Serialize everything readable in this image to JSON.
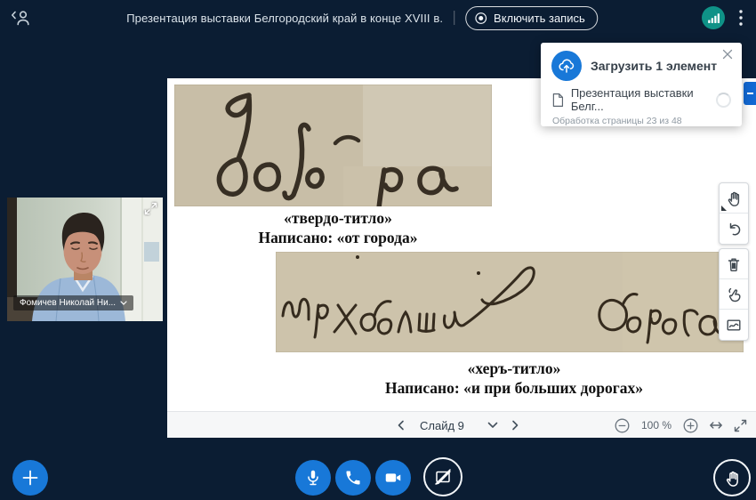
{
  "topbar": {
    "title": "Презентация выставки Белгородский край в конце XVIII в.",
    "record_label": "Включить запись"
  },
  "upload": {
    "title": "Загрузить 1 элемент",
    "file_name": "Презентация выставки Белг...",
    "progress": "Обработка страницы 23 из 48"
  },
  "participant": {
    "name": "Фомичев Николай Ни..."
  },
  "slide": {
    "caption_top": {
      "line1": "«твердо-титло»",
      "line2": "Написано: «от города»"
    },
    "caption_bottom": {
      "line1": "«херъ-титло»",
      "line2": "Написано: «и при больших дорогах»"
    },
    "footer": {
      "slide_label": "Слайд 9",
      "zoom_level": "100 %"
    }
  },
  "colors": {
    "background_navy": "#0b1d33",
    "accent_blue": "#1878d8",
    "connection_teal": "#0f9287",
    "side_tab_blue": "#1268d3",
    "parchment": "#cbc1aa"
  },
  "icons": {
    "topbar": [
      "leave-person-icon",
      "record-icon",
      "signal-bars-icon",
      "kebab-menu-icon"
    ],
    "toolbar": [
      "pan-hand-icon",
      "undo-icon",
      "trash-icon",
      "pointer-finger-icon",
      "curve-chart-icon"
    ],
    "bottom_bar": [
      "plus-icon",
      "mic-icon",
      "phone-icon",
      "camera-icon",
      "screen-draw-icon",
      "raise-hand-icon"
    ],
    "slide_footer": [
      "prev-icon",
      "dropdown-icon",
      "next-icon",
      "zoom-out-icon",
      "zoom-in-icon",
      "fit-width-icon",
      "fullscreen-icon"
    ],
    "upload_panel": [
      "cloud-upload-icon",
      "document-icon",
      "spinner",
      "close-icon"
    ],
    "video_tile": [
      "expand-icon",
      "chevron-down-icon"
    ]
  }
}
